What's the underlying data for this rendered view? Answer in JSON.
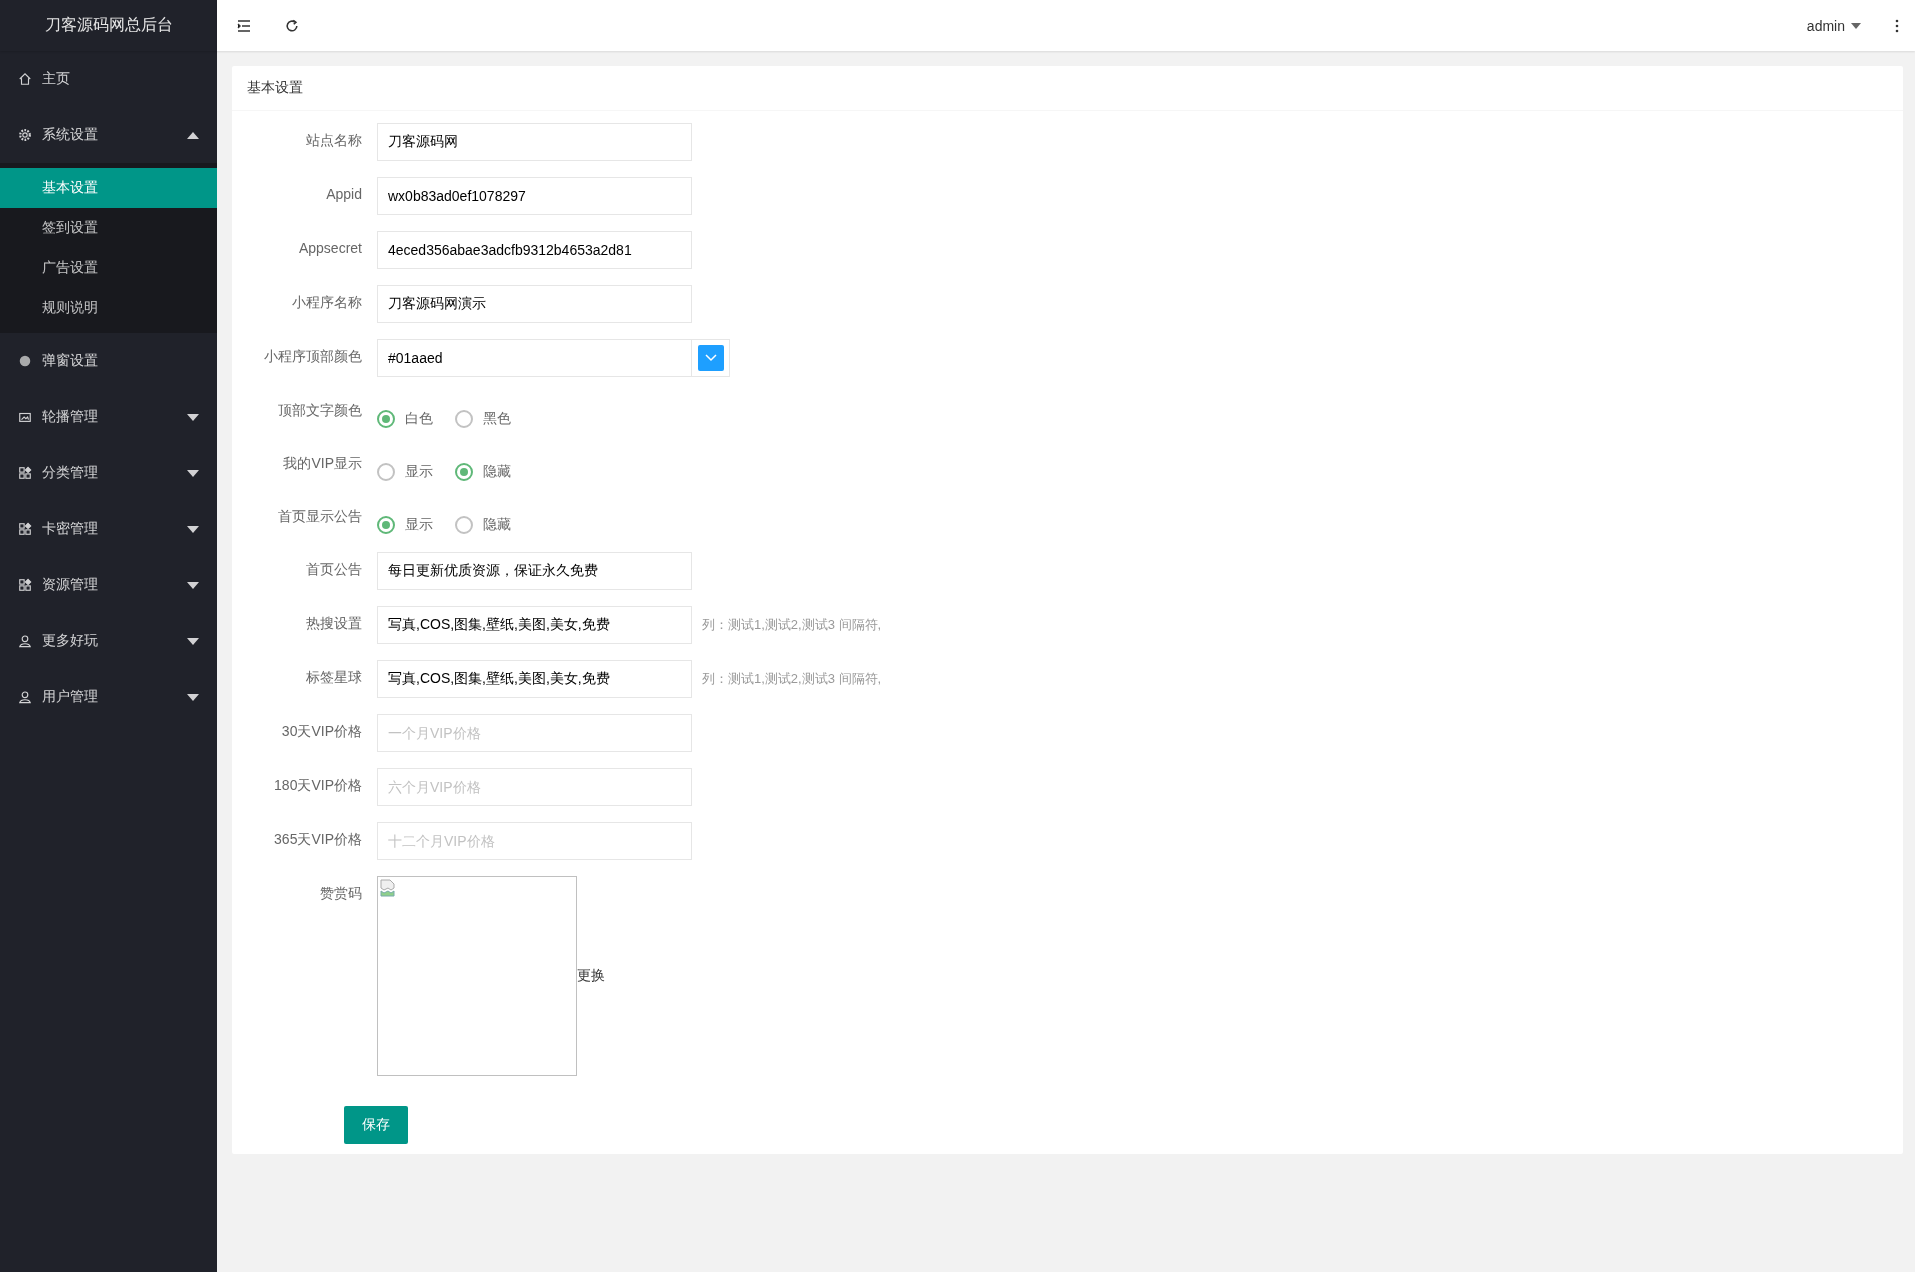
{
  "sidebar": {
    "title": "刀客源码网总后台",
    "items": [
      {
        "kind": "link",
        "label": "主页"
      },
      {
        "kind": "menu",
        "label": "系统设置",
        "expanded": true,
        "children": [
          {
            "label": "基本设置",
            "selected": true
          },
          {
            "label": "签到设置",
            "selected": false
          },
          {
            "label": "广告设置",
            "selected": false
          },
          {
            "label": "规则说明",
            "selected": false
          }
        ]
      },
      {
        "kind": "link",
        "label": "弹窗设置"
      },
      {
        "kind": "menu",
        "label": "轮播管理",
        "expanded": false
      },
      {
        "kind": "menu",
        "label": "分类管理",
        "expanded": false
      },
      {
        "kind": "menu",
        "label": "卡密管理",
        "expanded": false
      },
      {
        "kind": "menu",
        "label": "资源管理",
        "expanded": false
      },
      {
        "kind": "menu",
        "label": "更多好玩",
        "expanded": false
      },
      {
        "kind": "menu",
        "label": "用户管理",
        "expanded": false
      }
    ]
  },
  "topbar": {
    "user": "admin"
  },
  "card": {
    "title": "基本设置",
    "fields": [
      {
        "kind": "text",
        "label": "站点名称",
        "value": "刀客源码网"
      },
      {
        "kind": "text",
        "label": "Appid",
        "value": "wx0b83ad0ef1078297"
      },
      {
        "kind": "text",
        "label": "Appsecret",
        "value": "4eced356abae3adcfb9312b4653a2d81"
      },
      {
        "kind": "text",
        "label": "小程序名称",
        "value": "刀客源码网演示"
      },
      {
        "kind": "color",
        "label": "小程序顶部颜色",
        "value": "#01aaed",
        "color": "#1e9fff"
      },
      {
        "kind": "radio",
        "label": "顶部文字颜色",
        "options": [
          {
            "label": "白色",
            "selected": true
          },
          {
            "label": "黑色",
            "selected": false
          }
        ]
      },
      {
        "kind": "radio",
        "label": "我的VIP显示",
        "options": [
          {
            "label": "显示",
            "selected": false
          },
          {
            "label": "隐藏",
            "selected": true
          }
        ]
      },
      {
        "kind": "radio",
        "label": "首页显示公告",
        "options": [
          {
            "label": "显示",
            "selected": true
          },
          {
            "label": "隐藏",
            "selected": false
          }
        ]
      },
      {
        "kind": "text",
        "label": "首页公告",
        "value": "每日更新优质资源，保证永久免费"
      },
      {
        "kind": "text",
        "label": "热搜设置",
        "value": "写真,COS,图集,壁纸,美图,美女,免费",
        "hint": "列：测试1,测试2,测试3 间隔符,"
      },
      {
        "kind": "text",
        "label": "标签星球",
        "value": "写真,COS,图集,壁纸,美图,美女,免费",
        "hint": "列：测试1,测试2,测试3 间隔符,"
      },
      {
        "kind": "text",
        "label": "30天VIP价格",
        "placeholder": "一个月VIP价格"
      },
      {
        "kind": "text",
        "label": "180天VIP价格",
        "placeholder": "六个月VIP价格"
      },
      {
        "kind": "text",
        "label": "365天VIP价格",
        "placeholder": "十二个月VIP价格"
      },
      {
        "kind": "image",
        "label": "赞赏码",
        "action": "更换"
      }
    ],
    "submit": "保存"
  }
}
